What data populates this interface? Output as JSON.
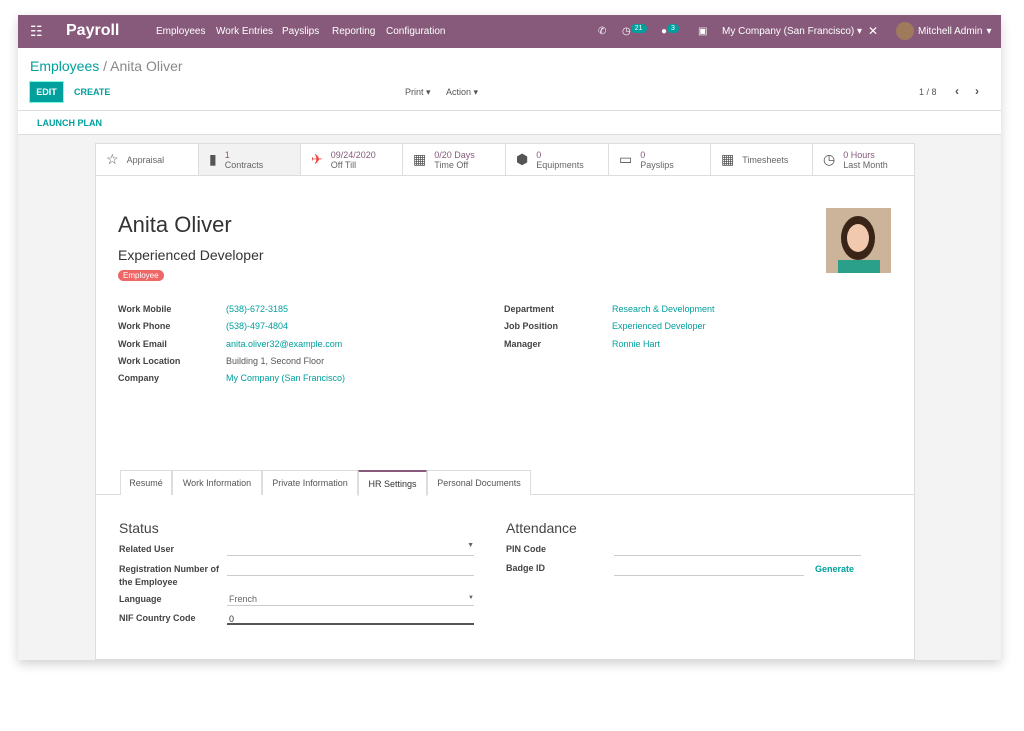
{
  "navbar": {
    "app": "Payroll",
    "menu": [
      "Employees",
      "Work Entries",
      "Payslips",
      "Reporting",
      "Configuration"
    ],
    "activity_count": "21",
    "message_count": "3",
    "company": "My Company (San Francisco)",
    "user": "Mitchell Admin",
    "color": "#875A7B"
  },
  "breadcrumb": {
    "parent": "Employees",
    "current": "Anita Oliver"
  },
  "controls": {
    "edit": "EDIT",
    "create": "CREATE",
    "print": "Print",
    "action": "Action",
    "pager": "1 / 8",
    "launch_plan": "LAUNCH PLAN"
  },
  "stats": [
    {
      "icon": "star-icon",
      "num": "",
      "label": "Appraisal"
    },
    {
      "icon": "book-icon",
      "num": "1",
      "label": "Contracts"
    },
    {
      "icon": "plane-icon",
      "num": "09/24/2020",
      "label": "Off Till"
    },
    {
      "icon": "calendar-icon",
      "num": "0/20 Days",
      "label": "Time Off"
    },
    {
      "icon": "cubes-icon",
      "num": "0",
      "label": "Equipments"
    },
    {
      "icon": "money-icon",
      "num": "0",
      "label": "Payslips"
    },
    {
      "icon": "calendar-icon",
      "num": "",
      "label": "Timesheets"
    },
    {
      "icon": "clock-icon",
      "num": "0 Hours",
      "label": "Last Month"
    }
  ],
  "employee": {
    "name": "Anita Oliver",
    "job_title": "Experienced Developer",
    "tag": "Employee"
  },
  "fields_left": [
    [
      "Work Mobile",
      "(538)-672-3185"
    ],
    [
      "Work Phone",
      "(538)-497-4804"
    ],
    [
      "Work Email",
      "anita.oliver32@example.com"
    ],
    [
      "Work Location",
      "Building 1, Second Floor"
    ],
    [
      "Company",
      "My Company (San Francisco)"
    ]
  ],
  "fields_right": [
    [
      "Department",
      "Research & Development"
    ],
    [
      "Job Position",
      "Experienced Developer"
    ],
    [
      "Manager",
      "Ronnie Hart"
    ]
  ],
  "tabs": [
    "Resumé",
    "Work Information",
    "Private Information",
    "HR Settings",
    "Personal Documents"
  ],
  "hr": {
    "status_title": "Status",
    "related_user": "Related User",
    "reg_no": "Registration Number of the Employee",
    "language": "Language",
    "language_value": "French",
    "nif": "NIF Country Code",
    "nif_value": "0",
    "attendance_title": "Attendance",
    "pin": "PIN Code",
    "badge": "Badge ID",
    "generate": "Generate"
  }
}
